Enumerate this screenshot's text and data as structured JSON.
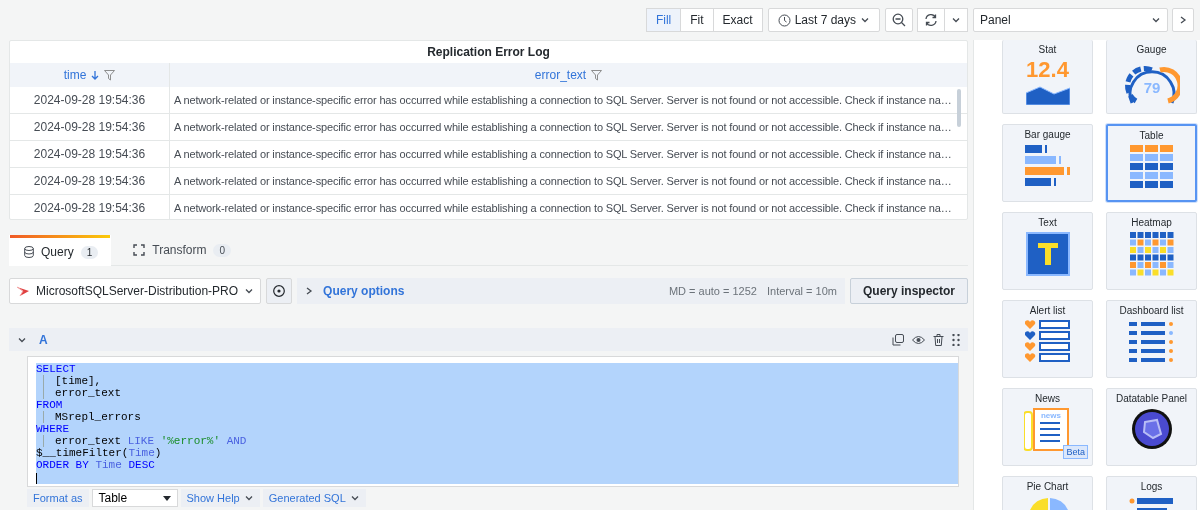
{
  "toolbar": {
    "scale_modes": [
      {
        "label": "Fill",
        "selected": true
      },
      {
        "label": "Fit",
        "selected": false
      },
      {
        "label": "Exact",
        "selected": false
      }
    ],
    "time_range": "Last 7 days"
  },
  "table_panel": {
    "title": "Replication Error Log",
    "columns": [
      {
        "label": "time",
        "sorted_descending": true
      },
      {
        "label": "error_text",
        "sorted_descending": false
      }
    ],
    "rows": [
      {
        "time": "2024-09-28 19:54:36",
        "error_text": "A network-related or instance-specific error has occurred while establishing a connection to SQL Server. Server is not found or not accessible. Check if instance na…"
      },
      {
        "time": "2024-09-28 19:54:36",
        "error_text": "A network-related or instance-specific error has occurred while establishing a connection to SQL Server. Server is not found or not accessible. Check if instance na…"
      },
      {
        "time": "2024-09-28 19:54:36",
        "error_text": "A network-related or instance-specific error has occurred while establishing a connection to SQL Server. Server is not found or not accessible. Check if instance na…"
      },
      {
        "time": "2024-09-28 19:54:36",
        "error_text": "A network-related or instance-specific error has occurred while establishing a connection to SQL Server. Server is not found or not accessible. Check if instance na…"
      },
      {
        "time": "2024-09-28 19:54:36",
        "error_text": "A network-related or instance-specific error has occurred while establishing a connection to SQL Server. Server is not found or not accessible. Check if instance na…"
      }
    ]
  },
  "query_tabs": [
    {
      "label": "Query",
      "count": "1",
      "selected": true
    },
    {
      "label": "Transform",
      "count": "0",
      "selected": false
    }
  ],
  "data_source": "MicrosoftSQLServer-Distribution-PRO",
  "query_options": {
    "label": "Query options",
    "max_data_points": "MD = auto = 1252",
    "interval": "Interval = 10m"
  },
  "query_inspector": "Query inspector",
  "query": {
    "ref_id": "A",
    "expanded": true,
    "editor": {
      "selected": true,
      "lines": [
        {
          "indent": false,
          "tokens": [
            {
              "kind": "keyword",
              "text": "SELECT"
            }
          ]
        },
        {
          "indent": true,
          "tokens": [
            {
              "kind": "plain",
              "text": "[time],"
            }
          ]
        },
        {
          "indent": true,
          "tokens": [
            {
              "kind": "plain",
              "text": "error_text"
            }
          ]
        },
        {
          "indent": false,
          "tokens": [
            {
              "kind": "keyword",
              "text": "FROM"
            }
          ]
        },
        {
          "indent": true,
          "tokens": [
            {
              "kind": "plain",
              "text": "MSrepl_errors"
            }
          ]
        },
        {
          "indent": false,
          "tokens": [
            {
              "kind": "keyword",
              "text": "WHERE"
            }
          ]
        },
        {
          "indent": true,
          "tokens": [
            {
              "kind": "plain",
              "text": "error_text "
            },
            {
              "kind": "operator",
              "text": "LIKE "
            },
            {
              "kind": "string",
              "text": "'%error%' "
            },
            {
              "kind": "operator",
              "text": "AND"
            }
          ]
        },
        {
          "indent": false,
          "tokens": [
            {
              "kind": "plain",
              "text": "$__timeFilter("
            },
            {
              "kind": "operator",
              "text": "Time"
            },
            {
              "kind": "plain",
              "text": ")"
            }
          ]
        },
        {
          "indent": false,
          "tokens": [
            {
              "kind": "keyword",
              "text": "ORDER BY "
            },
            {
              "kind": "operator",
              "text": "Time "
            },
            {
              "kind": "keyword",
              "text": "DESC"
            }
          ]
        }
      ]
    },
    "format_label": "Format as",
    "format_value": "Table",
    "help_button": "Show Help",
    "sql_button": "Generated SQL"
  },
  "visualization_picker": {
    "value": "Panel",
    "cards": [
      {
        "kind": "stat",
        "label": "Stat",
        "value": "12.4",
        "selected": false
      },
      {
        "kind": "gauge",
        "label": "Gauge",
        "value": "79",
        "selected": false
      },
      {
        "kind": "bargauge",
        "label": "Bar gauge",
        "selected": false
      },
      {
        "kind": "table",
        "label": "Table",
        "selected": true
      },
      {
        "kind": "text",
        "label": "Text",
        "selected": false
      },
      {
        "kind": "heatmap",
        "label": "Heatmap",
        "selected": false
      },
      {
        "kind": "alertlist",
        "label": "Alert list",
        "selected": false
      },
      {
        "kind": "dashlist",
        "label": "Dashboard list",
        "selected": false
      },
      {
        "kind": "news",
        "label": "News",
        "value": "news",
        "badge": "Beta",
        "selected": false
      },
      {
        "kind": "datatable",
        "label": "Datatable Panel",
        "selected": false
      },
      {
        "kind": "piechart",
        "label": "Pie Chart",
        "selected": false
      },
      {
        "kind": "logs",
        "label": "Logs",
        "selected": false
      }
    ]
  }
}
